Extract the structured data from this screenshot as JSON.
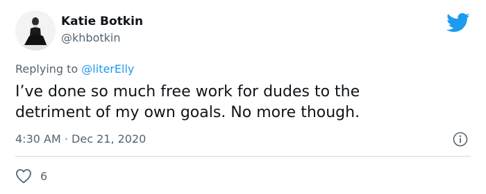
{
  "author": {
    "display_name": "Katie Botkin",
    "handle": "@khbotkin"
  },
  "reply": {
    "prefix": "Replying to ",
    "mention": "@literElly"
  },
  "tweet": {
    "lines": [
      "I’ve done so much free work for dudes to the",
      "detriment of my own goals. No more though."
    ],
    "time": "4:30 AM",
    "separator": " · ",
    "date": "Dec 21, 2020"
  },
  "engagement": {
    "like_count": "6"
  },
  "icons": {
    "brand": "twitter-bird-icon",
    "info": "info-icon",
    "like": "heart-icon"
  },
  "colors": {
    "brand": "#1d9bf0",
    "secondary_text": "#536471",
    "text": "#0f1419",
    "divider": "#cfd9de"
  }
}
